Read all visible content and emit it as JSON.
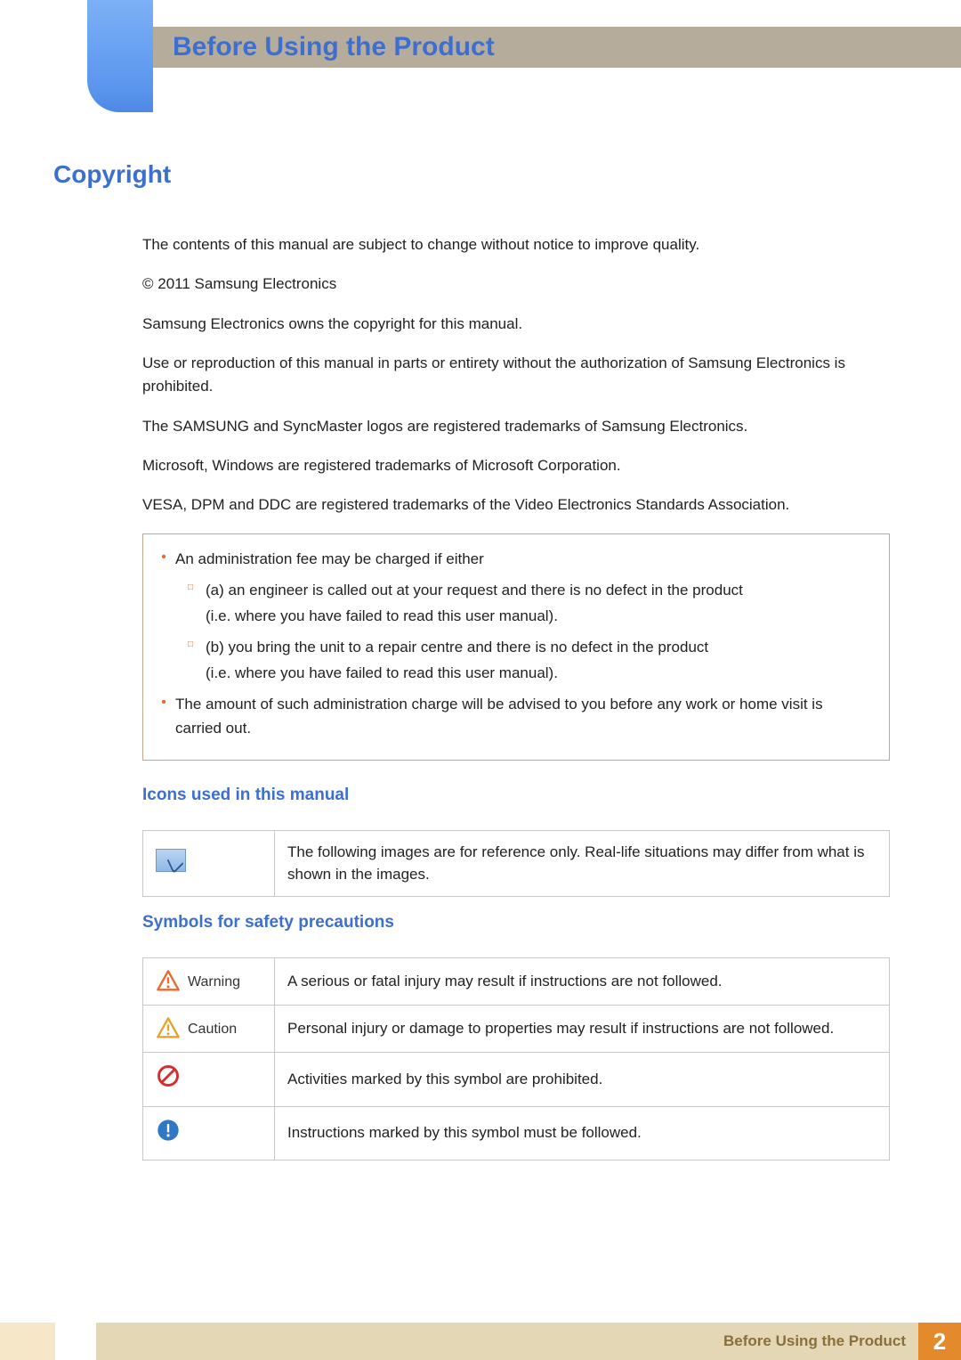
{
  "header": {
    "title": "Before Using the Product"
  },
  "section": {
    "copyright_title": "Copyright",
    "paragraphs": {
      "p1": "The contents of this manual are subject to change without notice to improve quality.",
      "p2": "© 2011 Samsung Electronics",
      "p3": "Samsung Electronics owns the copyright for this manual.",
      "p4": "Use or reproduction of this manual in parts or entirety without the authorization of Samsung Electronics is prohibited.",
      "p5": "The SAMSUNG and SyncMaster logos are registered trademarks of Samsung Electronics.",
      "p6": "Microsoft, Windows are registered trademarks of Microsoft Corporation.",
      "p7": "VESA, DPM and DDC are registered trademarks of the Video Electronics Standards Association."
    },
    "admin_box": {
      "intro": "An administration fee may be charged if either",
      "a": "(a) an engineer is called out at your request and there is no defect in the product",
      "a_note": "(i.e. where you have failed to read this user manual).",
      "b": "(b) you bring the unit to a repair centre and there is no defect in the product",
      "b_note": "(i.e. where you have failed to read this user manual).",
      "outro": "The amount of such administration charge will be advised to you before any work or home visit is carried out."
    },
    "icons_title": "Icons used in this manual",
    "icons_table": {
      "note_desc": "The following images are for reference only. Real-life situations may differ from what is shown in the images."
    },
    "symbols_title": "Symbols for safety precautions",
    "symbols_table": {
      "warning_label": "Warning",
      "warning_desc": "A serious or fatal injury may result if instructions are not followed.",
      "caution_label": "Caution",
      "caution_desc": "Personal injury or damage to properties may result if instructions are not followed.",
      "prohibited_desc": "Activities marked by this symbol are prohibited.",
      "mustfollow_desc": "Instructions marked by this symbol must be followed."
    }
  },
  "footer": {
    "text": "Before Using the Product",
    "page": "2"
  }
}
